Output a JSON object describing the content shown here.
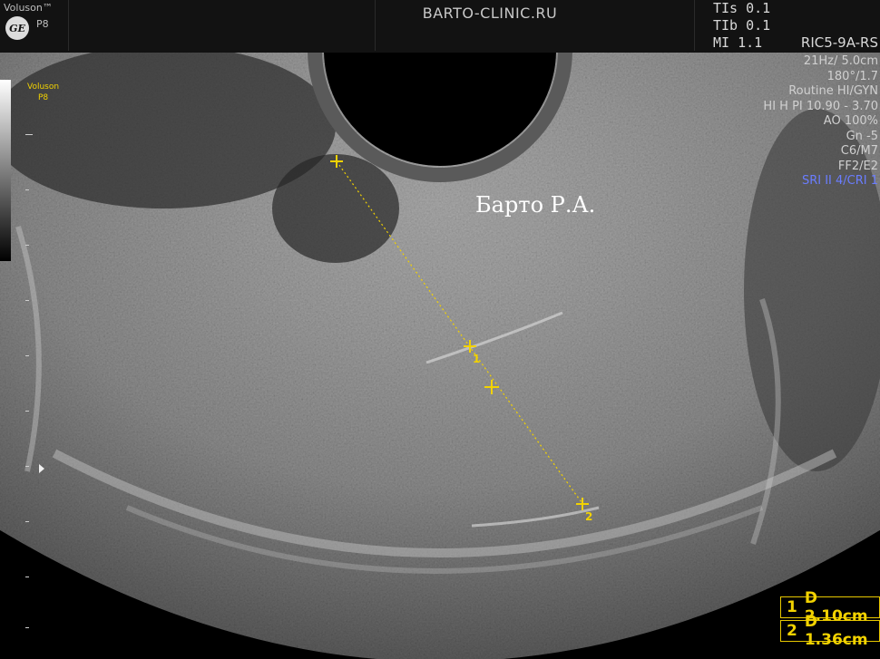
{
  "header": {
    "system_name": "Voluson™",
    "probe_model": "P8",
    "logo_text": "GE",
    "clinic": "BARTO-CLINIC.RU",
    "tis": "TIs 0.1",
    "tib": "TIb 0.1",
    "mi": "MI 1.1",
    "probe_id": "RIC5-9A-RS"
  },
  "side": {
    "brand": "Voluson",
    "model": "P8"
  },
  "params": [
    "21Hz/ 5.0cm",
    "180°/1.7",
    "Routine HI/GYN",
    "HI H PI 10.90 - 3.70",
    "AO 100%",
    "Gn -5",
    "C6/M7",
    "FF2/E2"
  ],
  "params_highlight": "SRI II 4/CRI 1",
  "watermark": "Барто Р.А.",
  "measurements": [
    {
      "index": "1",
      "label": "D 2.10cm"
    },
    {
      "index": "2",
      "label": "D 1.36cm"
    }
  ],
  "caliper_labels": [
    "1",
    "2"
  ],
  "colors": {
    "caliper": "#f2d200",
    "highlight": "#6a7dff"
  }
}
